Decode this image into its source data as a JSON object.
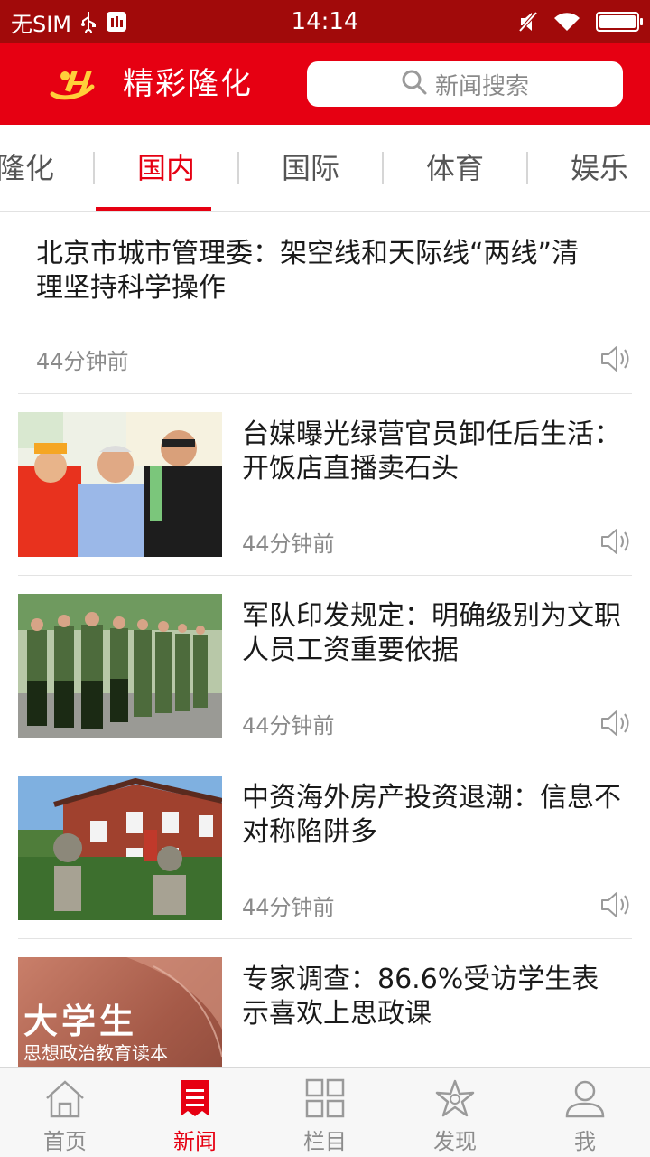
{
  "status_bar": {
    "carrier": "无SIM",
    "time": "14:14",
    "battery_level": 1.0
  },
  "header": {
    "app_title": "精彩隆化",
    "search_placeholder": "新闻搜索"
  },
  "tabs": [
    {
      "label": "隆化",
      "active": false
    },
    {
      "label": "国内",
      "active": true
    },
    {
      "label": "国际",
      "active": false
    },
    {
      "label": "体育",
      "active": false
    },
    {
      "label": "娱乐",
      "active": false
    }
  ],
  "news": [
    {
      "title": "北京市城市管理委：架空线和天际线“两线”清理坚持科学操作",
      "time": "44分钟前",
      "has_image": false
    },
    {
      "title": "台媒曝光绿营官员卸任后生活：开饭店直播卖石头",
      "time": "44分钟前",
      "has_image": true,
      "image": "photo-men"
    },
    {
      "title": "军队印发规定：明确级别为文职人员工资重要依据",
      "time": "44分钟前",
      "has_image": true,
      "image": "photo-soldiers"
    },
    {
      "title": "中资海外房产投资退潮：信息不对称陷阱多",
      "time": "44分钟前",
      "has_image": true,
      "image": "photo-house"
    },
    {
      "title": "专家调查：86.6%受访学生表示喜欢上思政课",
      "time": "",
      "has_image": true,
      "image": "photo-book",
      "image_text": {
        "big": "大学生",
        "small": "思想政治教育读本"
      }
    }
  ],
  "bottom_nav": [
    {
      "label": "首页",
      "icon": "home-icon",
      "active": false
    },
    {
      "label": "新闻",
      "icon": "news-icon",
      "active": true
    },
    {
      "label": "栏目",
      "icon": "grid-icon",
      "active": false
    },
    {
      "label": "发现",
      "icon": "star-icon",
      "active": false
    },
    {
      "label": "我",
      "icon": "user-icon",
      "active": false
    }
  ],
  "colors": {
    "brand_red": "#e60012",
    "status_bar": "#a10a0a",
    "text_gray": "#8a8a8a"
  }
}
